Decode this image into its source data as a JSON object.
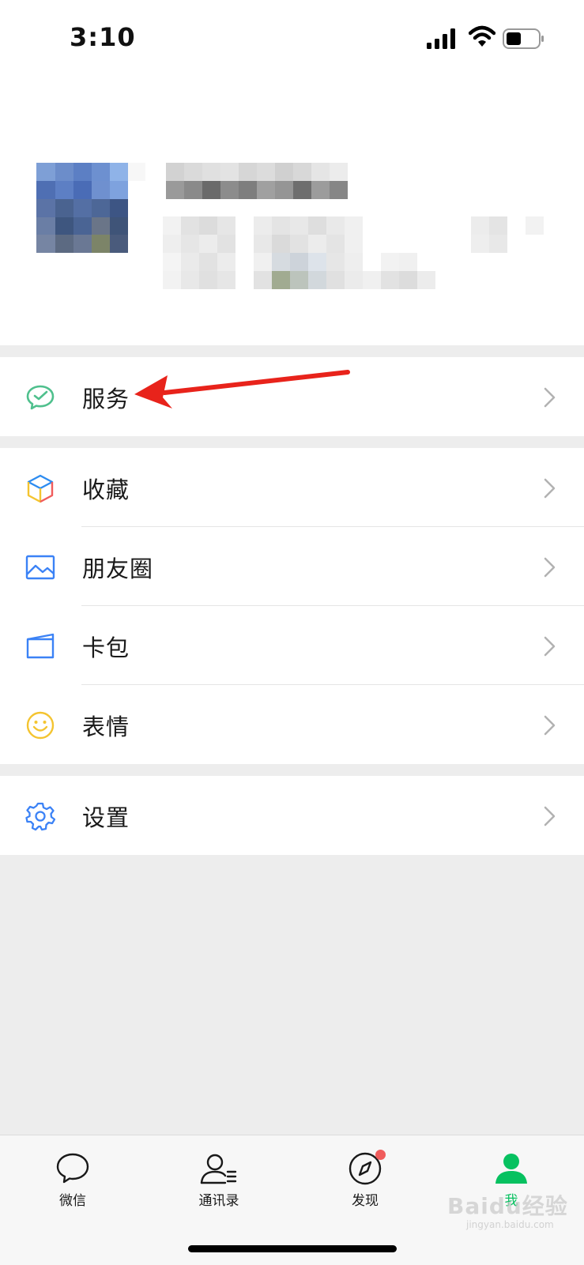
{
  "status_bar": {
    "time": "3:10"
  },
  "menu": {
    "services": "服务",
    "favorites": "收藏",
    "moments": "朋友圈",
    "cards": "卡包",
    "stickers": "表情",
    "settings": "设置"
  },
  "tabs": {
    "chats": "微信",
    "contacts": "通讯录",
    "discover": "发现",
    "me": "我",
    "active": "我",
    "discover_has_badge": true
  },
  "colors": {
    "accent_green": "#07c160",
    "badge_red": "#f05c5c",
    "annotation_arrow": "#e8231b"
  },
  "watermark": {
    "brand": "Baidu经验",
    "url": "jingyan.baidu.com"
  }
}
